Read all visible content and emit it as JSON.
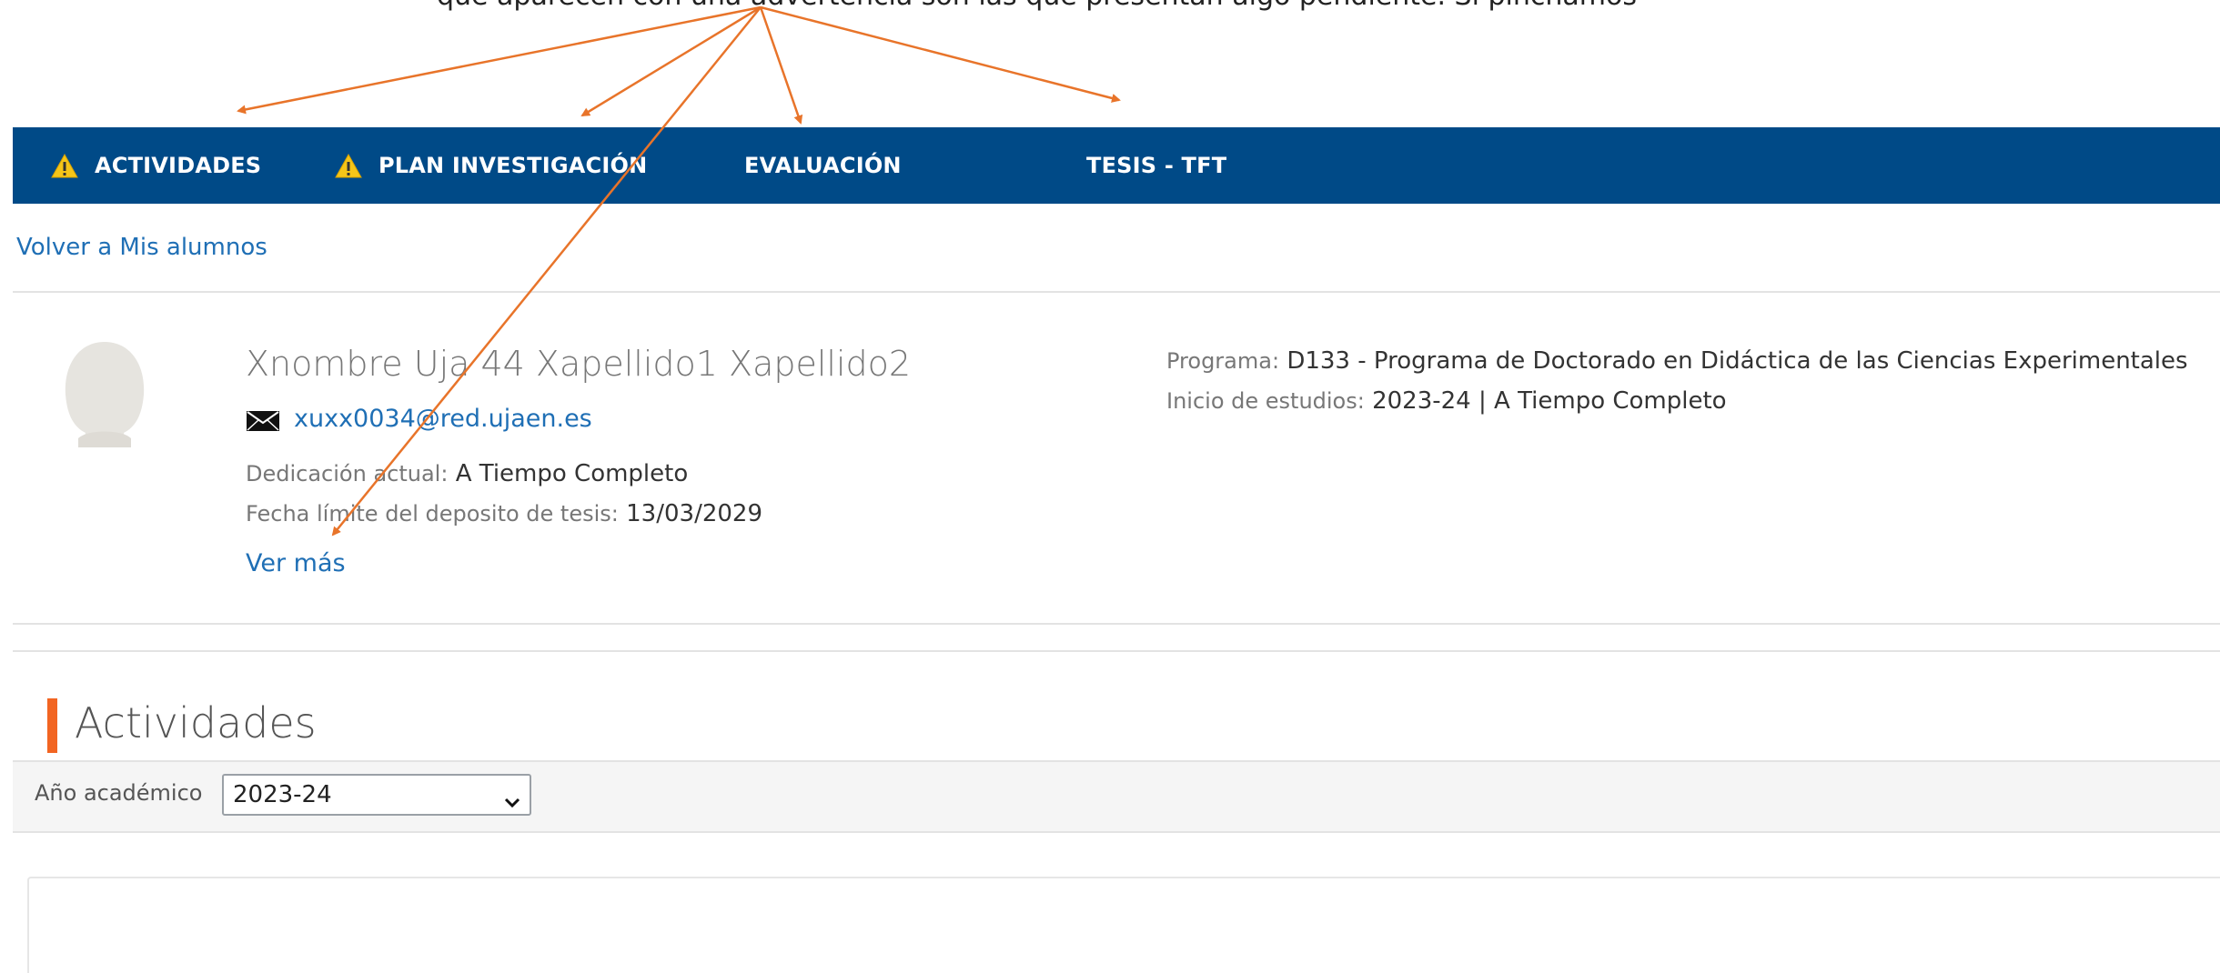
{
  "caption": "que aparecen con una advertencia son las que presentan algo pendiente. Si pinchamos",
  "nav": {
    "items": [
      {
        "label": "ACTIVIDADES",
        "warning": true
      },
      {
        "label": "PLAN INVESTIGACIÓN",
        "warning": true
      },
      {
        "label": "EVALUACIÓN",
        "warning": false
      },
      {
        "label": "TESIS - TFT",
        "warning": false
      }
    ]
  },
  "back_link": "Volver a Mis alumnos",
  "student": {
    "name": "Xnombre Uja 44 Xapellido1 Xapellido2",
    "email": "xuxx0034@red.ujaen.es",
    "dedication_label": "Dedicación actual:",
    "dedication_value": "A Tiempo Completo",
    "deadline_label": "Fecha límite del deposito de tesis:",
    "deadline_value": "13/03/2029",
    "more_link": "Ver más"
  },
  "program": {
    "program_label": "Programa:",
    "program_value": "D133 - Programa de Doctorado en Didáctica de las Ciencias Experimentales",
    "start_label": "Inicio de estudios:",
    "start_value": "2023-24 | A Tiempo Completo"
  },
  "section": {
    "title": "Actividades",
    "year_label": "Año académico",
    "year_selected": "2023-24"
  },
  "colors": {
    "nav_bg": "#004a87",
    "link": "#1f6fb5",
    "accent": "#f26522",
    "warning": "#f5c518",
    "arrow": "#e8742a"
  },
  "icons": [
    "warning-icon",
    "mail-icon",
    "avatar-placeholder",
    "chevron-down-icon"
  ]
}
